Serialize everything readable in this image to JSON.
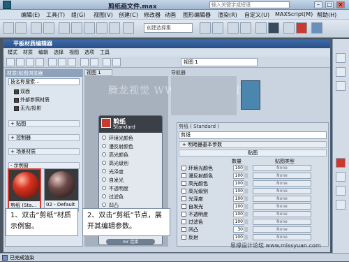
{
  "window": {
    "title": "剪纸画文件.max",
    "search_placeholder": "输入关键字或短语"
  },
  "menubar": [
    "编辑(E)",
    "工具(T)",
    "组(G)",
    "视图(V)",
    "创建(C)",
    "修改器",
    "动画",
    "图形编辑器",
    "渲染(R)",
    "自定义(U)",
    "MAXScript(M)",
    "帮助(H)"
  ],
  "toolbar": {
    "selection_set_placeholder": "创建选择集"
  },
  "slate": {
    "title": "平板材质编辑器",
    "menu": [
      "模式",
      "材质",
      "编辑",
      "选择",
      "视图",
      "选项",
      "工具"
    ],
    "view_combo": "视图 1",
    "browser": {
      "header": "材质/贴图浏览器",
      "search": "按名称搜索...",
      "items": [
        "双面",
        "外部参照材质",
        "无光/投影"
      ],
      "groups": [
        "+ 贴图",
        "+ 控制器",
        "+ 场景材质",
        "- 示例窗"
      ]
    },
    "slots": [
      {
        "label": "剪纸 (Sta...",
        "color": "#d8321f"
      },
      {
        "label": "02 - Default",
        "color": "#6a4a48"
      }
    ],
    "view_tab": "视图 1",
    "navigator": "导航器",
    "node": {
      "name": "剪纸",
      "type": "Standard",
      "slots": [
        "环境光颜色",
        "漫反射颜色",
        "高光颜色",
        "高光级别",
        "光泽度",
        "自发光",
        "不透明度",
        "过滤色",
        "凹凸"
      ],
      "footer": "mr 连接"
    },
    "params": {
      "title": "剪纸 ( Standard )",
      "material_name": "剪纸",
      "rollout_basic": "+ 明暗器基本参数",
      "rollout_maps": "贴图",
      "col_amount": "数量",
      "col_type": "贴图类型",
      "rows": [
        {
          "name": "环境光颜色",
          "amount": "100",
          "map": "None"
        },
        {
          "name": "漫反射颜色",
          "amount": "100",
          "map": "None"
        },
        {
          "name": "高光颜色",
          "amount": "100",
          "map": "None"
        },
        {
          "name": "高光级别",
          "amount": "100",
          "map": "None"
        },
        {
          "name": "光泽度",
          "amount": "100",
          "map": "None"
        },
        {
          "name": "自发光",
          "amount": "100",
          "map": "None"
        },
        {
          "name": "不透明度",
          "amount": "100",
          "map": "None"
        },
        {
          "name": "过滤色",
          "amount": "100",
          "map": "None"
        },
        {
          "name": "凹凸",
          "amount": "30",
          "map": "None"
        },
        {
          "name": "反射",
          "amount": "100",
          "map": "None"
        }
      ]
    }
  },
  "callouts": {
    "step1": "1、双击“剪纸”材质示例窗。",
    "step2": "2、双击“剪纸”节点，展开其编辑参数。"
  },
  "status": "已完成渲染",
  "watermark": "腾龙视觉 WWW.TLVI.NET",
  "credit": "思缘设计论坛 www.missyuan.com"
}
